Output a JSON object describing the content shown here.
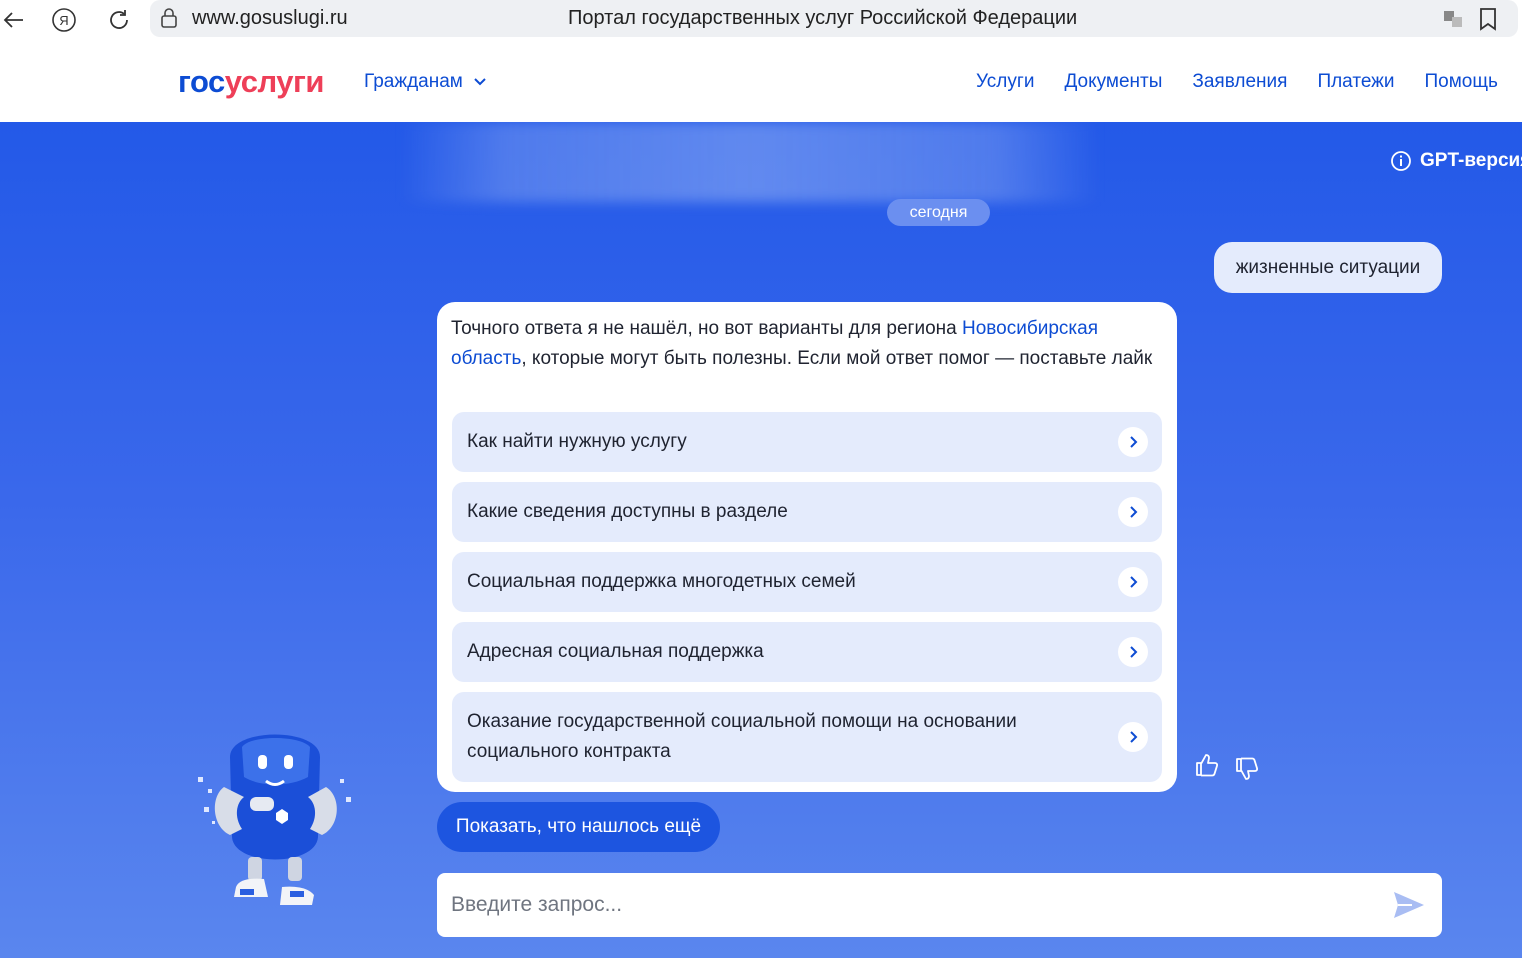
{
  "browser": {
    "url": "www.gosuslugi.ru",
    "title": "Портал государственных услуг Российской Федерации",
    "yandex_icon_letter": "Я"
  },
  "header": {
    "logo_part1": "гос",
    "logo_part2": "услуги",
    "citizens_label": "Гражданам",
    "nav": [
      "Услуги",
      "Документы",
      "Заявления",
      "Платежи",
      "Помощь"
    ]
  },
  "chat": {
    "gpt_version_label": "GPT-версия",
    "date_label": "сегодня",
    "user_message": "жизненные ситуации",
    "bot_message_part1": "Точного ответа я не нашёл, но вот варианты для региона ",
    "bot_message_region": "Новосибирская область",
    "bot_message_part2": ", которые могут быть полезны. Если мой ответ помог — поставьте лайк",
    "options": [
      "Как найти нужную услугу",
      "Какие сведения доступны в разделе",
      "Социальная поддержка многодетных семей",
      "Адресная социальная поддержка",
      "Оказание государственной социальной помощи на основании социального контракта"
    ],
    "show_more_label": "Показать, что нашлось ещё",
    "input_placeholder": "Введите запрос..."
  },
  "colors": {
    "brand_blue": "#0d4cd3",
    "brand_red": "#ee3f58",
    "chat_bg_top": "#2359e8",
    "chat_bg_bottom": "#5a86ee",
    "option_bg": "#e4ebfc",
    "show_more_bg": "#1d55e0"
  },
  "icons": [
    "back-arrow-icon",
    "yandex-icon",
    "reload-icon",
    "lock-icon",
    "translate-icon",
    "bookmark-icon",
    "chevron-down-icon",
    "info-icon",
    "chevron-right-icon",
    "thumbs-up-icon",
    "thumbs-down-icon",
    "send-icon",
    "mascot-robot"
  ]
}
